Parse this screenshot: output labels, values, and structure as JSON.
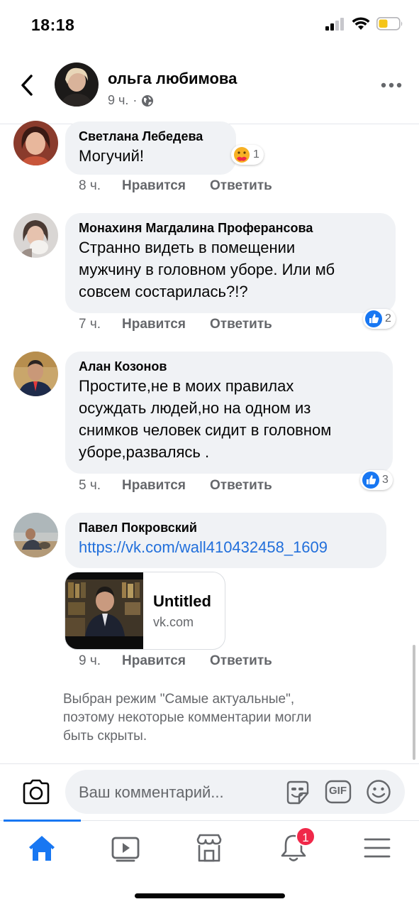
{
  "status_bar": {
    "time": "18:18"
  },
  "header": {
    "name": "ольга любимова",
    "time": "9 ч.",
    "separator": "·"
  },
  "comments": [
    {
      "author": "Светлана Лебедева",
      "text": "Могучий!",
      "time": "8 ч.",
      "like_label": "Нравится",
      "reply_label": "Ответить",
      "reaction_type": "care",
      "reaction_count": "1"
    },
    {
      "author": "Монахиня Магдалина Проферансова",
      "text_lines": [
        "Странно видеть в помещении",
        "мужчину в головном уборе. Или мб",
        "совсем состарилась?!?"
      ],
      "time": "7 ч.",
      "like_label": "Нравится",
      "reply_label": "Ответить",
      "reaction_type": "like",
      "reaction_count": "2"
    },
    {
      "author": "Алан Козонов",
      "text_lines": [
        "Простите,не в моих правилах",
        "осуждать людей,но на одном из",
        "снимков человек сидит в головном",
        "уборе,развалясь ."
      ],
      "time": "5 ч.",
      "like_label": "Нравится",
      "reply_label": "Ответить",
      "reaction_type": "like",
      "reaction_count": "3"
    },
    {
      "author": "Павел Покровский",
      "link": "https://vk.com/wall410432458_1609",
      "preview": {
        "title": "Untitled",
        "domain": "vk.com"
      },
      "time": "9 ч.",
      "like_label": "Нравится",
      "reply_label": "Ответить"
    }
  ],
  "filter_note": [
    "Выбран режим \"Самые актуальные\",",
    "поэтому некоторые комментарии могли",
    "быть скрыты."
  ],
  "composer": {
    "placeholder": "Ваш комментарий...",
    "gif_label": "GIF"
  },
  "tabbar": {
    "tabs": [
      "home",
      "watch",
      "marketplace",
      "notifications",
      "menu"
    ],
    "active": "home",
    "notifications_badge": "1"
  },
  "colors": {
    "accent": "#1877f2",
    "link": "#216fdb",
    "badge": "#f02849",
    "bubble": "#f0f2f5",
    "secondary_text": "#65676b"
  }
}
